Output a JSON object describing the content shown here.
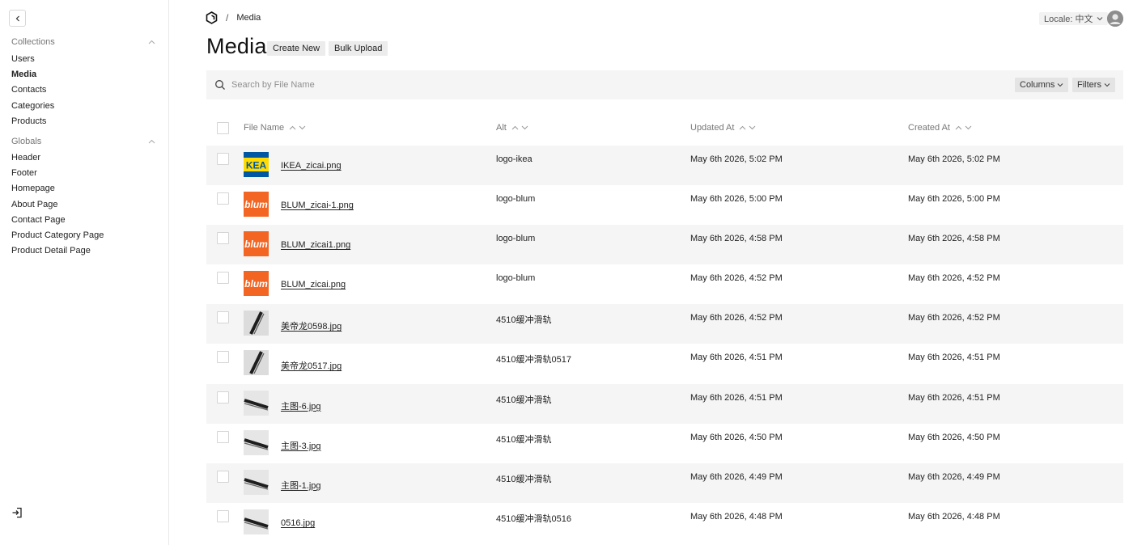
{
  "sidebar": {
    "collections_label": "Collections",
    "collections": [
      {
        "label": "Users",
        "active": false
      },
      {
        "label": "Media",
        "active": true
      },
      {
        "label": "Contacts",
        "active": false
      },
      {
        "label": "Categories",
        "active": false
      },
      {
        "label": "Products",
        "active": false
      }
    ],
    "globals_label": "Globals",
    "globals": [
      {
        "label": "Header"
      },
      {
        "label": "Footer"
      },
      {
        "label": "Homepage"
      },
      {
        "label": "About Page"
      },
      {
        "label": "Contact Page"
      },
      {
        "label": "Product Category Page"
      },
      {
        "label": "Product Detail Page"
      }
    ]
  },
  "header": {
    "breadcrumb_separator": "/",
    "breadcrumb_current": "Media",
    "locale_label": "Locale: 中文",
    "title": "Media",
    "create_new_label": "Create New",
    "bulk_upload_label": "Bulk Upload"
  },
  "search": {
    "placeholder": "Search by File Name",
    "value": "",
    "columns_label": "Columns",
    "filters_label": "Filters"
  },
  "table": {
    "columns": {
      "file_name": "File Name",
      "alt": "Alt",
      "updated_at": "Updated At",
      "created_at": "Created At"
    },
    "rows": [
      {
        "file": "IKEA_zicai.png",
        "alt": "logo-ikea",
        "updated": "May 6th 2026, 5:02 PM",
        "created": "May 6th 2026, 5:02 PM",
        "thumb": "ikea"
      },
      {
        "file": "BLUM_zicai-1.png",
        "alt": "logo-blum",
        "updated": "May 6th 2026, 5:00 PM",
        "created": "May 6th 2026, 5:00 PM",
        "thumb": "blum"
      },
      {
        "file": "BLUM_zicai1.png",
        "alt": "logo-blum",
        "updated": "May 6th 2026, 4:58 PM",
        "created": "May 6th 2026, 4:58 PM",
        "thumb": "blum"
      },
      {
        "file": "BLUM_zicai.png",
        "alt": "logo-blum",
        "updated": "May 6th 2026, 4:52 PM",
        "created": "May 6th 2026, 4:52 PM",
        "thumb": "blum"
      },
      {
        "file": "美帝龙0598.jpg",
        "alt": "4510缓冲滑轨",
        "updated": "May 6th 2026, 4:52 PM",
        "created": "May 6th 2026, 4:52 PM",
        "thumb": "rail-diag"
      },
      {
        "file": "美帝龙0517.jpg",
        "alt": "4510缓冲滑轨0517",
        "updated": "May 6th 2026, 4:51 PM",
        "created": "May 6th 2026, 4:51 PM",
        "thumb": "rail-diag"
      },
      {
        "file": "主图-6.jpg",
        "alt": "4510缓冲滑轨",
        "updated": "May 6th 2026, 4:51 PM",
        "created": "May 6th 2026, 4:51 PM",
        "thumb": "rail"
      },
      {
        "file": "主图-3.jpg",
        "alt": "4510缓冲滑轨",
        "updated": "May 6th 2026, 4:50 PM",
        "created": "May 6th 2026, 4:50 PM",
        "thumb": "rail"
      },
      {
        "file": "主图-1.jpg",
        "alt": "4510缓冲滑轨",
        "updated": "May 6th 2026, 4:49 PM",
        "created": "May 6th 2026, 4:49 PM",
        "thumb": "rail"
      },
      {
        "file": "0516.jpg",
        "alt": "4510缓冲滑轨0516",
        "updated": "May 6th 2026, 4:48 PM",
        "created": "May 6th 2026, 4:48 PM",
        "thumb": "rail"
      }
    ]
  }
}
